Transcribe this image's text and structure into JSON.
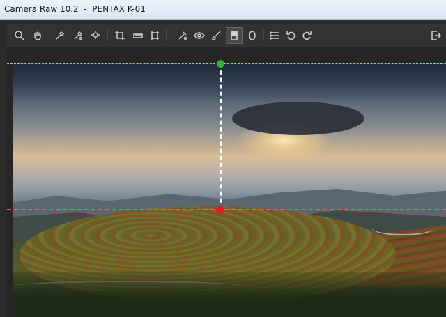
{
  "window": {
    "title": "Camera Raw 10.2  -  PENTAX K-01"
  },
  "toolbar": {
    "tools": [
      {
        "name": "zoom-tool",
        "icon": "magnifier-icon"
      },
      {
        "name": "hand-tool",
        "icon": "hand-icon"
      },
      {
        "name": "white-balance-tool",
        "icon": "eyedropper-icon"
      },
      {
        "name": "color-sampler-tool",
        "icon": "color-sampler-icon"
      },
      {
        "name": "targeted-adjustment-tool",
        "icon": "target-adjust-icon"
      },
      {
        "name": "crop-tool",
        "icon": "crop-icon"
      },
      {
        "name": "straighten-tool",
        "icon": "straighten-icon"
      },
      {
        "name": "transform-tool",
        "icon": "transform-icon"
      },
      {
        "name": "spot-removal-tool",
        "icon": "spot-removal-icon"
      },
      {
        "name": "red-eye-tool",
        "icon": "red-eye-icon"
      },
      {
        "name": "adjustment-brush-tool",
        "icon": "brush-icon"
      },
      {
        "name": "graduated-filter-tool",
        "icon": "graduated-filter-icon"
      },
      {
        "name": "radial-filter-tool",
        "icon": "radial-filter-icon"
      },
      {
        "name": "preferences-tool",
        "icon": "list-icon"
      },
      {
        "name": "rotate-left-tool",
        "icon": "rotate-ccw-icon"
      },
      {
        "name": "rotate-right-tool",
        "icon": "rotate-cw-icon"
      },
      {
        "name": "open-preferences-exit",
        "icon": "export-icon"
      }
    ],
    "active_tool": "graduated-filter-tool"
  },
  "overlay": {
    "guide_colors": {
      "vertical": "#ffffff",
      "top_edge": "#7fe07f",
      "horizon": "#ff5a5a",
      "start_handle": "#33b533",
      "end_handle": "#e01e1e"
    }
  }
}
